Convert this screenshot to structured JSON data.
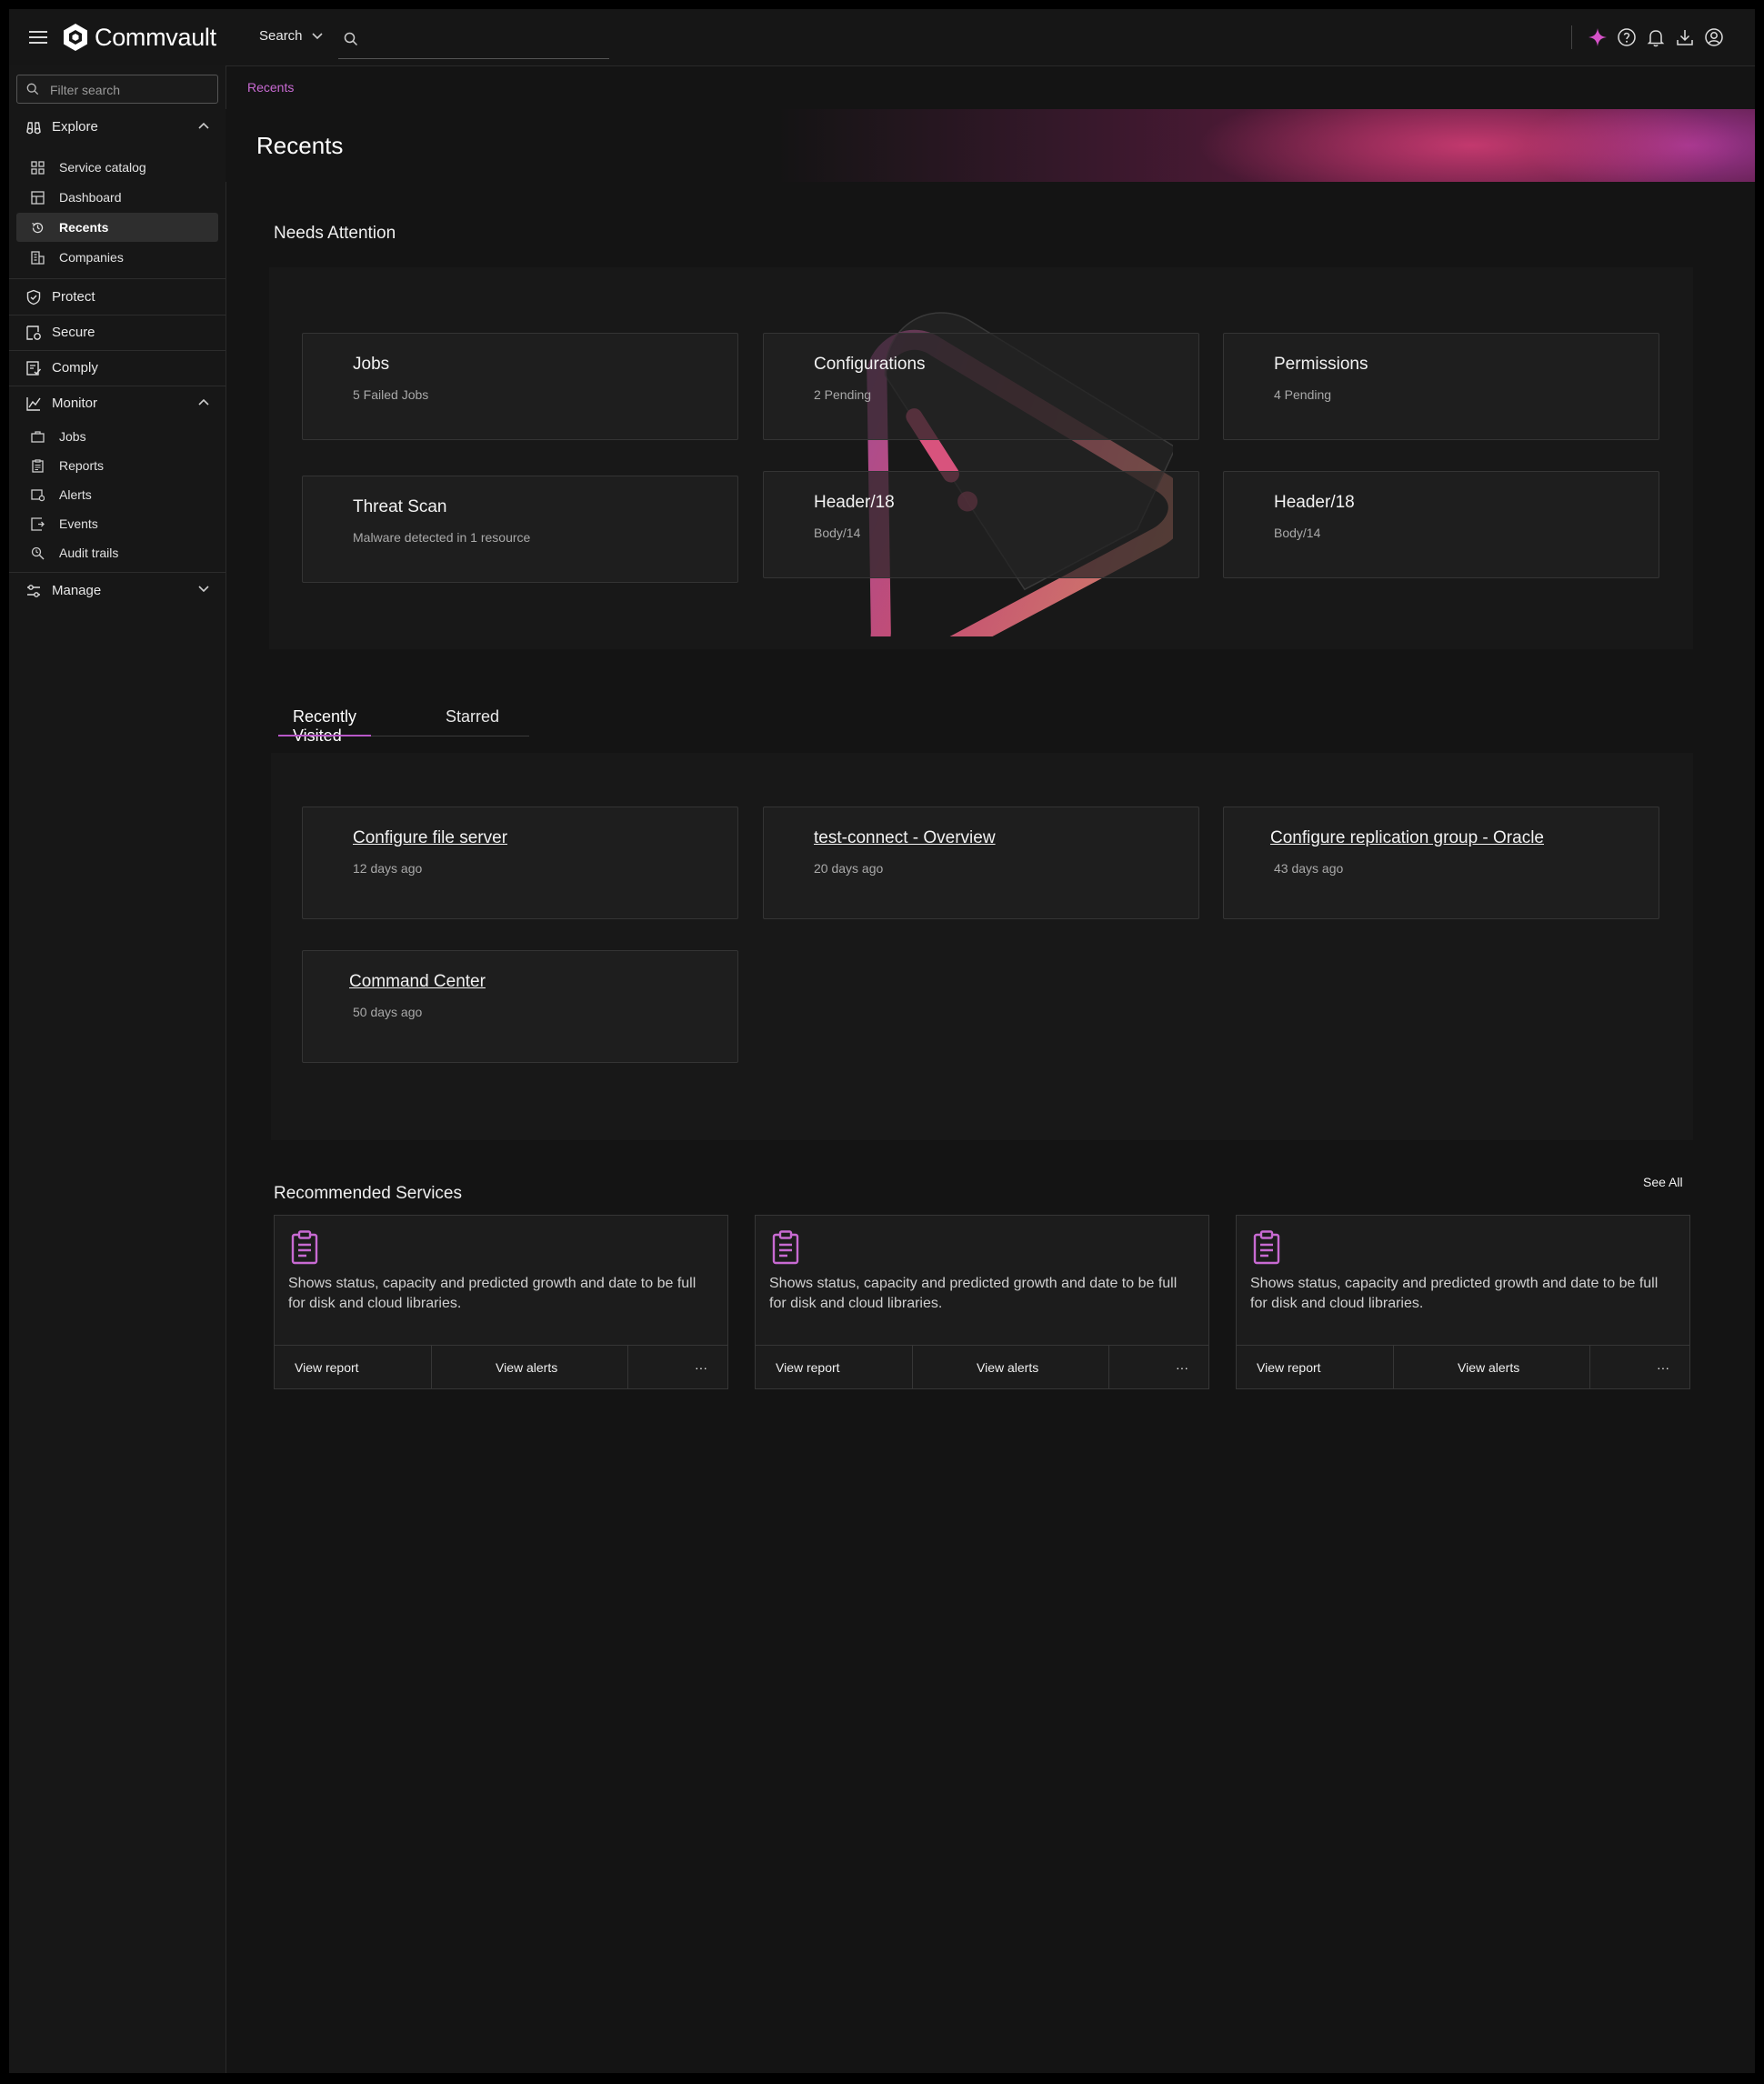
{
  "header": {
    "brand": "Commvault",
    "search_scope": "Search",
    "search_value": "",
    "icons": [
      "sparkle-icon",
      "help-icon",
      "bell-icon",
      "download-icon",
      "user-icon"
    ],
    "accent_color": "#c86ad2"
  },
  "sidebar": {
    "filter_placeholder": "Filter search",
    "explore": {
      "label": "Explore",
      "items": [
        {
          "label": "Service catalog",
          "icon": "grid-icon"
        },
        {
          "label": "Dashboard",
          "icon": "dashboard-icon"
        },
        {
          "label": "Recents",
          "icon": "history-icon",
          "active": true
        },
        {
          "label": "Companies",
          "icon": "building-icon"
        }
      ]
    },
    "protect": "Protect",
    "secure": "Secure",
    "comply": "Comply",
    "monitor": {
      "label": "Monitor",
      "items": [
        {
          "label": "Jobs",
          "icon": "briefcase-icon"
        },
        {
          "label": "Reports",
          "icon": "clipboard-icon"
        },
        {
          "label": "Alerts",
          "icon": "alert-icon"
        },
        {
          "label": "Events",
          "icon": "event-icon"
        },
        {
          "label": "Audit trails",
          "icon": "audit-icon"
        }
      ]
    },
    "manage": "Manage"
  },
  "breadcrumb": "Recents",
  "page_title": "Recents",
  "needs_attention": {
    "title": "Needs Attention",
    "cards": [
      {
        "title": "Jobs",
        "sub": "5 Failed Jobs"
      },
      {
        "title": "Configurations",
        "sub": "2 Pending"
      },
      {
        "title": "Permissions",
        "sub": "4 Pending"
      },
      {
        "title": "Threat Scan",
        "sub": "Malware detected in 1 resource"
      },
      {
        "title": "Header/18",
        "sub": "Body/14"
      },
      {
        "title": "Header/18",
        "sub": "Body/14"
      }
    ]
  },
  "tabs": {
    "recently_visited": "Recently Visited",
    "starred": "Starred"
  },
  "recent": [
    {
      "title": "Configure file server",
      "sub": "12 days ago"
    },
    {
      "title": "test-connect - Overview",
      "sub": "20 days ago"
    },
    {
      "title": "Configure replication group - Oracle",
      "sub": "43 days ago"
    },
    {
      "title": "Command Center",
      "sub": "50 days ago"
    }
  ],
  "recommended": {
    "title": "Recommended Services",
    "see_all": "See All",
    "cards": [
      {
        "desc": "Shows status, capacity and predicted growth and date to be full for disk and cloud libraries.",
        "view_report": "View report",
        "view_alerts": "View alerts",
        "more": "···"
      },
      {
        "desc": "Shows status, capacity and predicted growth and date to be full for disk and cloud libraries.",
        "view_report": "View report",
        "view_alerts": "View alerts",
        "more": "···"
      },
      {
        "desc": "Shows status, capacity and predicted growth and date to be full for disk and cloud libraries.",
        "view_report": "View report",
        "view_alerts": "View alerts",
        "more": "···"
      }
    ]
  }
}
